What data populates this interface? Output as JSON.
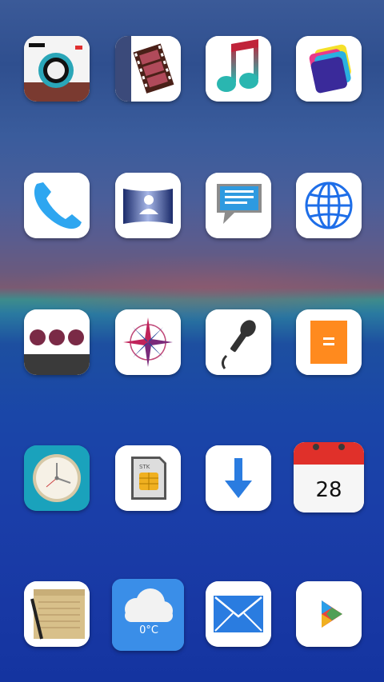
{
  "home_screen": {
    "apps": [
      {
        "id": "camera",
        "icon": "camera-icon"
      },
      {
        "id": "video",
        "icon": "film-icon"
      },
      {
        "id": "music",
        "icon": "music-note-icon"
      },
      {
        "id": "gallery",
        "icon": "gallery-icon"
      },
      {
        "id": "phone",
        "icon": "phone-icon"
      },
      {
        "id": "contacts",
        "icon": "contacts-icon"
      },
      {
        "id": "messages",
        "icon": "message-icon"
      },
      {
        "id": "browser",
        "icon": "globe-icon"
      },
      {
        "id": "more",
        "icon": "dots-icon"
      },
      {
        "id": "compass",
        "icon": "compass-icon"
      },
      {
        "id": "recorder",
        "icon": "microphone-icon"
      },
      {
        "id": "calculator",
        "icon": "calculator-icon"
      },
      {
        "id": "clock",
        "icon": "clock-icon"
      },
      {
        "id": "sim-toolkit",
        "icon": "sim-card-icon",
        "text": "STK"
      },
      {
        "id": "downloads",
        "icon": "download-arrow-icon"
      },
      {
        "id": "calendar",
        "icon": "calendar-icon",
        "text": "28"
      },
      {
        "id": "notes",
        "icon": "notepad-icon"
      },
      {
        "id": "weather",
        "icon": "cloud-icon",
        "text": "0°C"
      },
      {
        "id": "email",
        "icon": "envelope-icon"
      },
      {
        "id": "play-store",
        "icon": "play-icon"
      }
    ]
  },
  "colors": {
    "camera_red": "#e03030",
    "camera_teal": "#2aa6b8",
    "music_red": "#c0233a",
    "music_teal": "#2ab6b0",
    "phone_blue": "#2ea6f0",
    "message_blue": "#2e9ae0",
    "globe_blue": "#1e6ee8",
    "dots_maroon": "#7a2a46",
    "calc_orange": "#ff8a1e",
    "clock_teal": "#1aa2bc",
    "download_blue": "#2a7ce0",
    "calendar_red": "#e0302a",
    "weather_blue": "#3a8ee8"
  }
}
